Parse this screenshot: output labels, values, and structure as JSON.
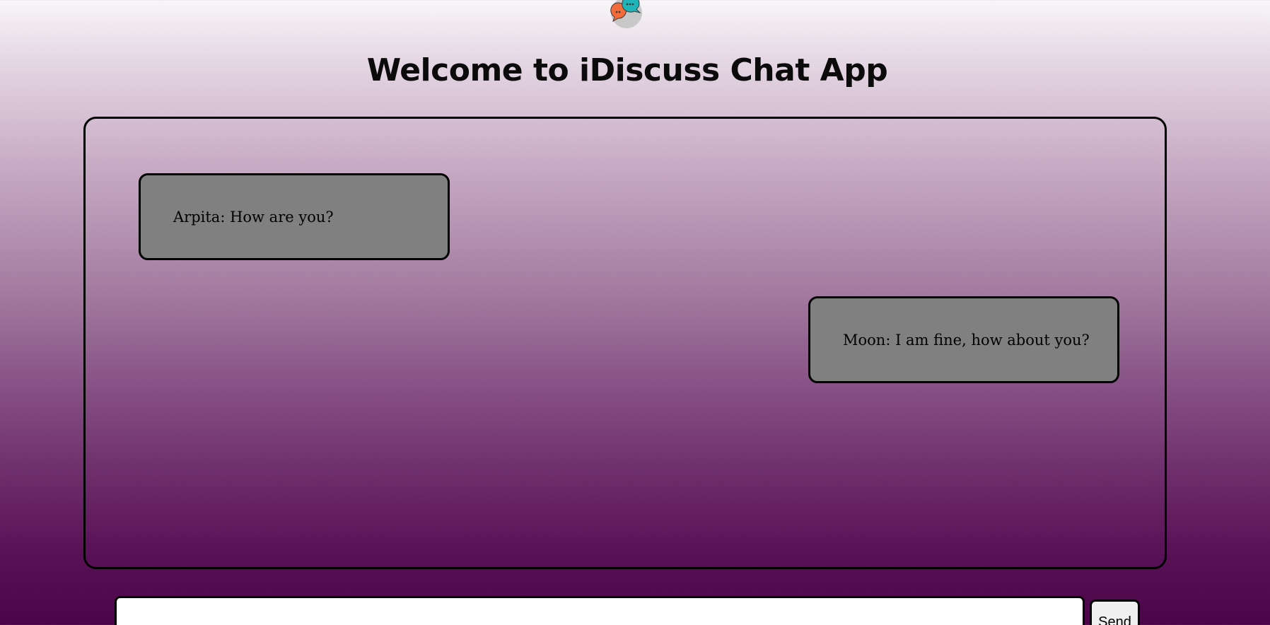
{
  "app": {
    "logo_icon": "chat-bubbles-icon",
    "title": "Welcome to iDiscuss Chat App"
  },
  "messages": [
    {
      "side": "left",
      "text": "Arpita: How are you?"
    },
    {
      "side": "right",
      "text": "Moon: I am fine, how about you?"
    }
  ],
  "composer": {
    "input_value": "",
    "send_label": "Send"
  },
  "colors": {
    "gradient_top": "#f8f6f8",
    "gradient_bottom": "#4c0449",
    "message_bg": "#808080",
    "border": "#000000"
  }
}
